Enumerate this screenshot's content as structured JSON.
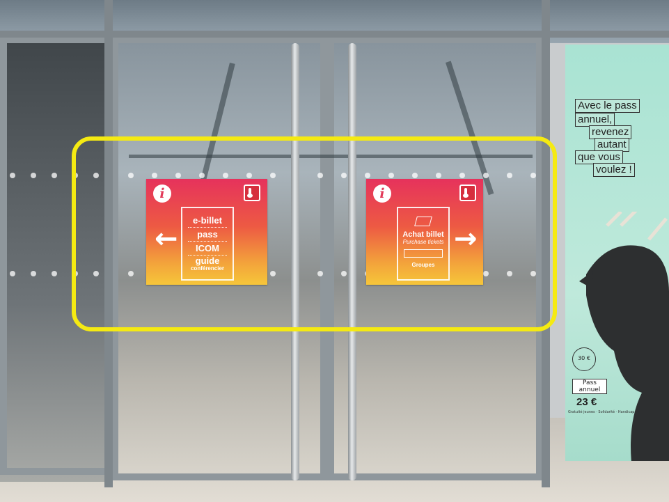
{
  "signs": {
    "left": {
      "info_glyph": "i",
      "items": [
        "e-billet",
        "pass",
        "ICOM",
        "guide"
      ],
      "guide_sub": "conférencier",
      "arrow": "←",
      "icon": "thermometer-icon"
    },
    "right": {
      "info_glyph": "i",
      "title": "Achat billet",
      "subtitle": "Purchase tickets",
      "groups": "Groupes",
      "arrow": "→",
      "icon": "thermometer-icon"
    }
  },
  "poster": {
    "lines": [
      "Avec le pass",
      "annuel,",
      "revenez",
      "autant",
      "que vous",
      "voulez !"
    ],
    "badge": "30 €",
    "pass_label": "Pass annuel",
    "price": "23 €",
    "footer": "Gratuité jeunes · Solidarité · Handicap"
  },
  "colors": {
    "highlight": "#f5ea12",
    "sign_top": "#e6325c",
    "sign_bottom": "#f6c63a",
    "poster": "#b5e6d6"
  }
}
